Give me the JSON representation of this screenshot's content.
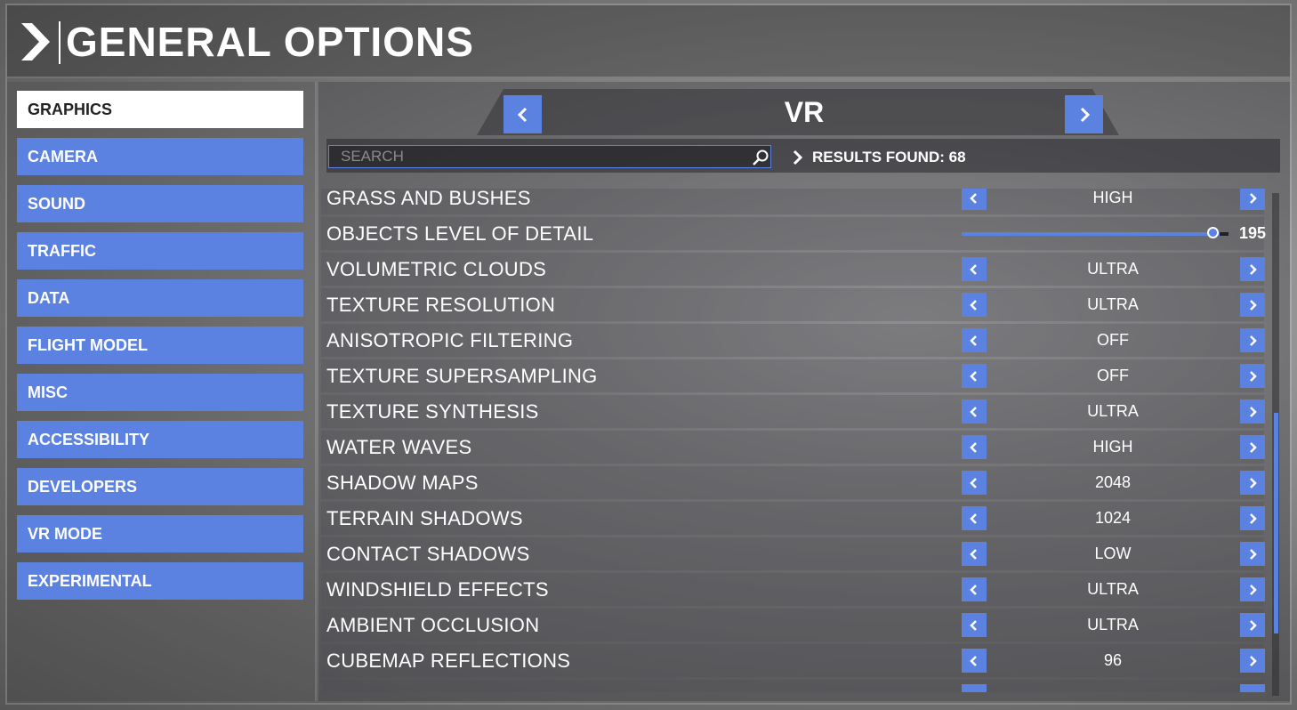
{
  "header": {
    "title": "GENERAL OPTIONS"
  },
  "sidebar": {
    "items": [
      {
        "label": "GRAPHICS",
        "active": true
      },
      {
        "label": "CAMERA"
      },
      {
        "label": "SOUND"
      },
      {
        "label": "TRAFFIC"
      },
      {
        "label": "DATA"
      },
      {
        "label": "FLIGHT MODEL"
      },
      {
        "label": "MISC"
      },
      {
        "label": "ACCESSIBILITY"
      },
      {
        "label": "DEVELOPERS"
      },
      {
        "label": "VR MODE"
      },
      {
        "label": "EXPERIMENTAL"
      }
    ]
  },
  "main": {
    "section_title": "VR",
    "search": {
      "placeholder": "SEARCH",
      "value": ""
    },
    "results_label": "RESULTS FOUND: 68",
    "settings": [
      {
        "label": "GRASS AND BUSHES",
        "value": "HIGH"
      },
      {
        "label": "OBJECTS LEVEL OF DETAIL",
        "value": "195",
        "slider": true
      },
      {
        "label": "VOLUMETRIC CLOUDS",
        "value": "ULTRA"
      },
      {
        "label": "TEXTURE RESOLUTION",
        "value": "ULTRA"
      },
      {
        "label": "ANISOTROPIC FILTERING",
        "value": "OFF"
      },
      {
        "label": "TEXTURE SUPERSAMPLING",
        "value": "OFF"
      },
      {
        "label": "TEXTURE SYNTHESIS",
        "value": "ULTRA"
      },
      {
        "label": "WATER WAVES",
        "value": "HIGH"
      },
      {
        "label": "SHADOW MAPS",
        "value": "2048"
      },
      {
        "label": "TERRAIN SHADOWS",
        "value": "1024"
      },
      {
        "label": "CONTACT SHADOWS",
        "value": "LOW"
      },
      {
        "label": "WINDSHIELD EFFECTS",
        "value": "ULTRA"
      },
      {
        "label": "AMBIENT OCCLUSION",
        "value": "ULTRA"
      },
      {
        "label": "CUBEMAP REFLECTIONS",
        "value": "96"
      }
    ]
  },
  "colors": {
    "accent": "#5b82e0",
    "active_item_bg": "#ffffff",
    "text": "#ffffff"
  },
  "icons": [
    "header-chevron-icon",
    "chevron-left-icon",
    "chevron-right-icon",
    "search-icon"
  ]
}
